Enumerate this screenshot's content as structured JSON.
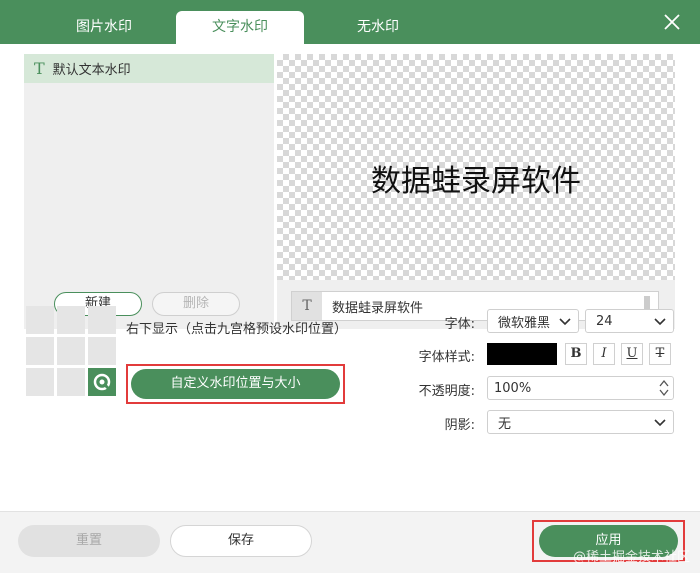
{
  "tabs": {
    "image": "图片水印",
    "text": "文字水印",
    "none": "无水印"
  },
  "list": {
    "item": "默认文本水印",
    "new_button": "新建",
    "delete_button": "删除"
  },
  "preview": {
    "text": "数据蛙录屏软件"
  },
  "editor": {
    "value": "数据蛙录屏软件"
  },
  "position": {
    "description": "右下显示（点击九宫格预设水印位置）",
    "custom_button": "自定义水印位置与大小",
    "selected_cell": "bottom-right"
  },
  "form": {
    "font_label": "字体:",
    "font_value": "微软雅黑",
    "size_value": "24",
    "style_label": "字体样式:",
    "color": "#000000",
    "bold": "B",
    "italic": "I",
    "underline": "U",
    "strike": "T",
    "opacity_label": "不透明度:",
    "opacity_value": "100%",
    "shadow_label": "阴影:",
    "shadow_value": "无"
  },
  "footer": {
    "reset_button": "重置",
    "save_button": "保存",
    "apply_button": "应用",
    "overlay_watermark": "@稀土掘金技术社区"
  },
  "colors": {
    "accent": "#4a8f5c",
    "highlight_border": "#e23b3b"
  }
}
